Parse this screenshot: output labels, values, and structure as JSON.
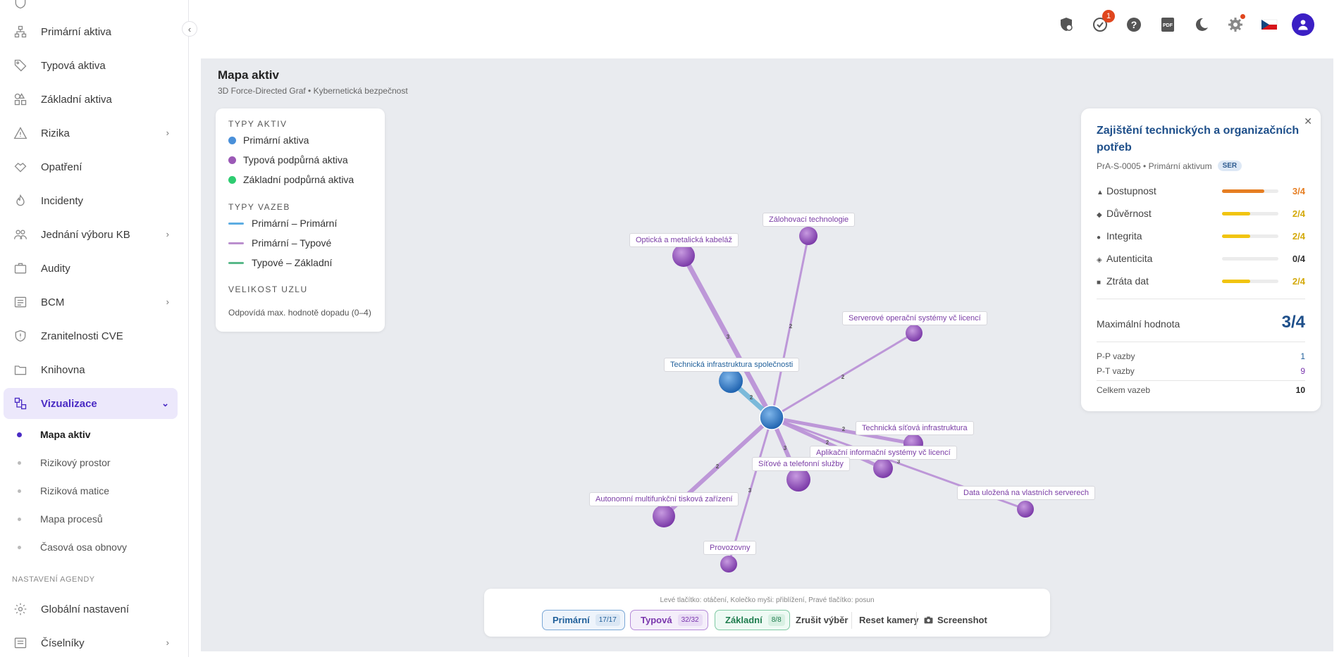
{
  "sidebar": {
    "collapse_icon": "chevron-left-icon",
    "items": [
      {
        "label": "Primární aktiva",
        "icon": "network-icon",
        "chevron": false
      },
      {
        "label": "Typová aktiva",
        "icon": "tag-icon",
        "chevron": false
      },
      {
        "label": "Základní aktiva",
        "icon": "shapes-icon",
        "chevron": false
      },
      {
        "label": "Rizika",
        "icon": "warning-icon",
        "chevron": true
      },
      {
        "label": "Opatření",
        "icon": "handshake-icon",
        "chevron": false
      },
      {
        "label": "Incidenty",
        "icon": "fire-icon",
        "chevron": false
      },
      {
        "label": "Jednání výboru KB",
        "icon": "people-icon",
        "chevron": true
      },
      {
        "label": "Audity",
        "icon": "briefcase-icon",
        "chevron": false
      },
      {
        "label": "BCM",
        "icon": "list-icon",
        "chevron": true
      },
      {
        "label": "Zranitelnosti CVE",
        "icon": "shield-icon",
        "chevron": false
      },
      {
        "label": "Knihovna",
        "icon": "folder-icon",
        "chevron": false
      },
      {
        "label": "Vizualizace",
        "icon": "diagram-icon",
        "chevron": true,
        "active": true
      }
    ],
    "subitems": [
      {
        "label": "Mapa aktiv",
        "active": true
      },
      {
        "label": "Rizikový prostor"
      },
      {
        "label": "Riziková matice"
      },
      {
        "label": "Mapa procesů"
      },
      {
        "label": "Časová osa obnovy"
      }
    ],
    "settings_section": "NASTAVENÍ AGENDY",
    "settings_items": [
      {
        "label": "Globální nastavení",
        "icon": "gear-icon",
        "chevron": false
      },
      {
        "label": "Číselníky",
        "icon": "list-icon",
        "chevron": true
      }
    ]
  },
  "topbar": {
    "notification_count": "1",
    "icons": [
      "security-shield-icon",
      "task-check-icon",
      "help-icon",
      "pdf-icon",
      "dark-mode-icon",
      "settings-icon",
      "czech-flag-icon",
      "user-avatar-icon"
    ]
  },
  "page": {
    "title": "Mapa aktiv",
    "subtitle": "3D Force-Directed Graf • Kybernetická bezpečnost"
  },
  "legend": {
    "asset_types_heading": "TYPY AKTIV",
    "asset_types": [
      {
        "label": "Primární aktiva",
        "color": "#4a90d9"
      },
      {
        "label": "Typová podpůrná aktiva",
        "color": "#9b59b6"
      },
      {
        "label": "Základní podpůrná aktiva",
        "color": "#2ecc71"
      }
    ],
    "link_types_heading": "TYPY VAZEB",
    "link_types": [
      {
        "label": "Primární – Primární",
        "color": "#5dade2"
      },
      {
        "label": "Primární – Typové",
        "color": "#bb8fce"
      },
      {
        "label": "Typové – Základní",
        "color": "#58b889"
      }
    ],
    "size_heading": "VELIKOST UZLU",
    "size_note": "Odpovídá max. hodnotě dopadu (0–4)"
  },
  "graph": {
    "nodes": [
      {
        "id": "hub",
        "label": "",
        "type": "primary"
      },
      {
        "id": "tis",
        "label": "Technická infrastruktura společnosti",
        "type": "primary"
      },
      {
        "id": "okab",
        "label": "Optická a metalická kabeláž",
        "type": "typed"
      },
      {
        "id": "zal",
        "label": "Zálohovací technologie",
        "type": "typed"
      },
      {
        "id": "srv",
        "label": "Serverové operační systémy vč licencí",
        "type": "typed"
      },
      {
        "id": "tsi",
        "label": "Technická síťová infrastruktura",
        "type": "typed"
      },
      {
        "id": "apl",
        "label": "Aplikační informační systémy vč licencí",
        "type": "typed"
      },
      {
        "id": "sit",
        "label": "Síťové a telefonní služby",
        "type": "typed"
      },
      {
        "id": "dat",
        "label": "Data uložená na vlastních serverech",
        "type": "typed"
      },
      {
        "id": "aut",
        "label": "Autonomní multifunkční tisková zařízení",
        "type": "typed"
      },
      {
        "id": "prv",
        "label": "Provozovny",
        "type": "typed"
      }
    ],
    "link_values": [
      "3",
      "2",
      "2",
      "2",
      "2",
      "3",
      "3",
      "2",
      "3",
      "2"
    ]
  },
  "detail": {
    "title": "Zajištění technických a organizačních potřeb",
    "code_meta": "PrA-S-0005 • Primární aktivum",
    "tag": "SER",
    "metrics": [
      {
        "glyph": "▲",
        "label": "Dostupnost",
        "value": "3/4",
        "fraction": 0.75,
        "color": "#e67e22"
      },
      {
        "glyph": "◆",
        "label": "Důvěrnost",
        "value": "2/4",
        "fraction": 0.5,
        "color": "#f1c40f"
      },
      {
        "glyph": "●",
        "label": "Integrita",
        "value": "2/4",
        "fraction": 0.5,
        "color": "#f1c40f"
      },
      {
        "glyph": "◈",
        "label": "Autenticita",
        "value": "0/4",
        "fraction": 0,
        "color": "#333333"
      },
      {
        "glyph": "■",
        "label": "Ztráta dat",
        "value": "2/4",
        "fraction": 0.5,
        "color": "#f1c40f"
      }
    ],
    "max_label": "Maximální hodnota",
    "max_value": "3/4",
    "pp_label": "P-P vazby",
    "pp_value": "1",
    "pt_label": "P-T vazby",
    "pt_value": "9",
    "total_label": "Celkem vazeb",
    "total_value": "10"
  },
  "toolbar": {
    "hint": "Levé tlačítko: otáčení, Kolečko myši: přiblížení, Pravé tlačítko: posun",
    "primary_label": "Primární",
    "primary_count": "17/17",
    "typed_label": "Typová",
    "typed_count": "32/32",
    "basic_label": "Základní",
    "basic_count": "8/8",
    "clear_label": "Zrušit výběr",
    "reset_label": "Reset kamery",
    "screenshot_label": "Screenshot",
    "screenshot_icon": "camera-icon"
  }
}
